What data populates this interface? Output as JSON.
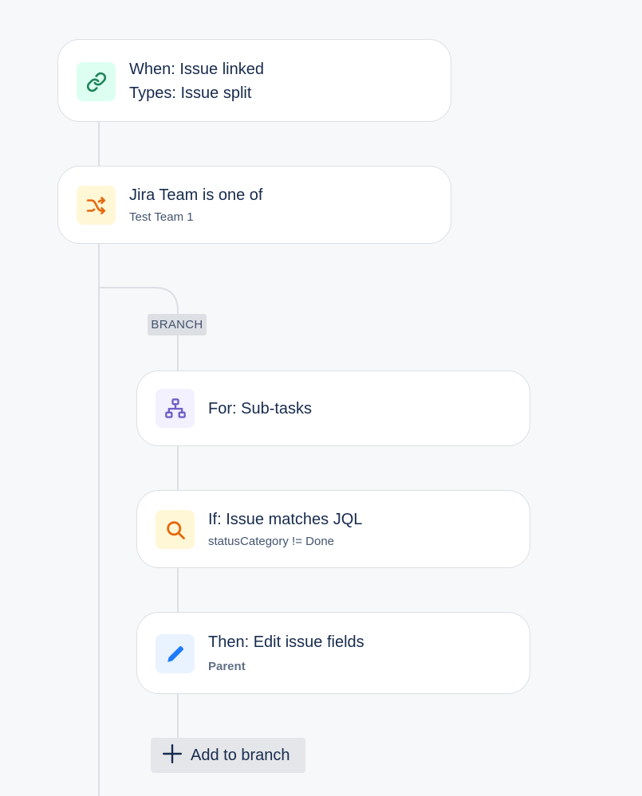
{
  "trigger": {
    "title": "When: Issue linked",
    "subtitle": "Types: Issue split",
    "icon": "link-icon",
    "icon_color": "#1f845a",
    "icon_bg": "#dcfff1"
  },
  "condition": {
    "title": "Jira Team is one of",
    "subtitle": "Test Team 1",
    "icon": "shuffle-icon",
    "icon_color": "#e56910",
    "icon_bg": "#fff7d6"
  },
  "branch": {
    "label": "BRANCH",
    "for_node": {
      "title": "For: Sub-tasks",
      "icon": "hierarchy-icon",
      "icon_color": "#6e5dc6",
      "icon_bg": "#f3f0ff"
    },
    "if_node": {
      "title": "If: Issue matches JQL",
      "subtitle": "statusCategory != Done",
      "icon": "search-icon",
      "icon_color": "#e56910",
      "icon_bg": "#fff7d6"
    },
    "then_node": {
      "title": "Then: Edit issue fields",
      "subtitle": "Parent",
      "icon": "pencil-icon",
      "icon_color": "#1d7afc",
      "icon_bg": "#e9f2ff"
    },
    "add_button_label": "Add to branch"
  }
}
